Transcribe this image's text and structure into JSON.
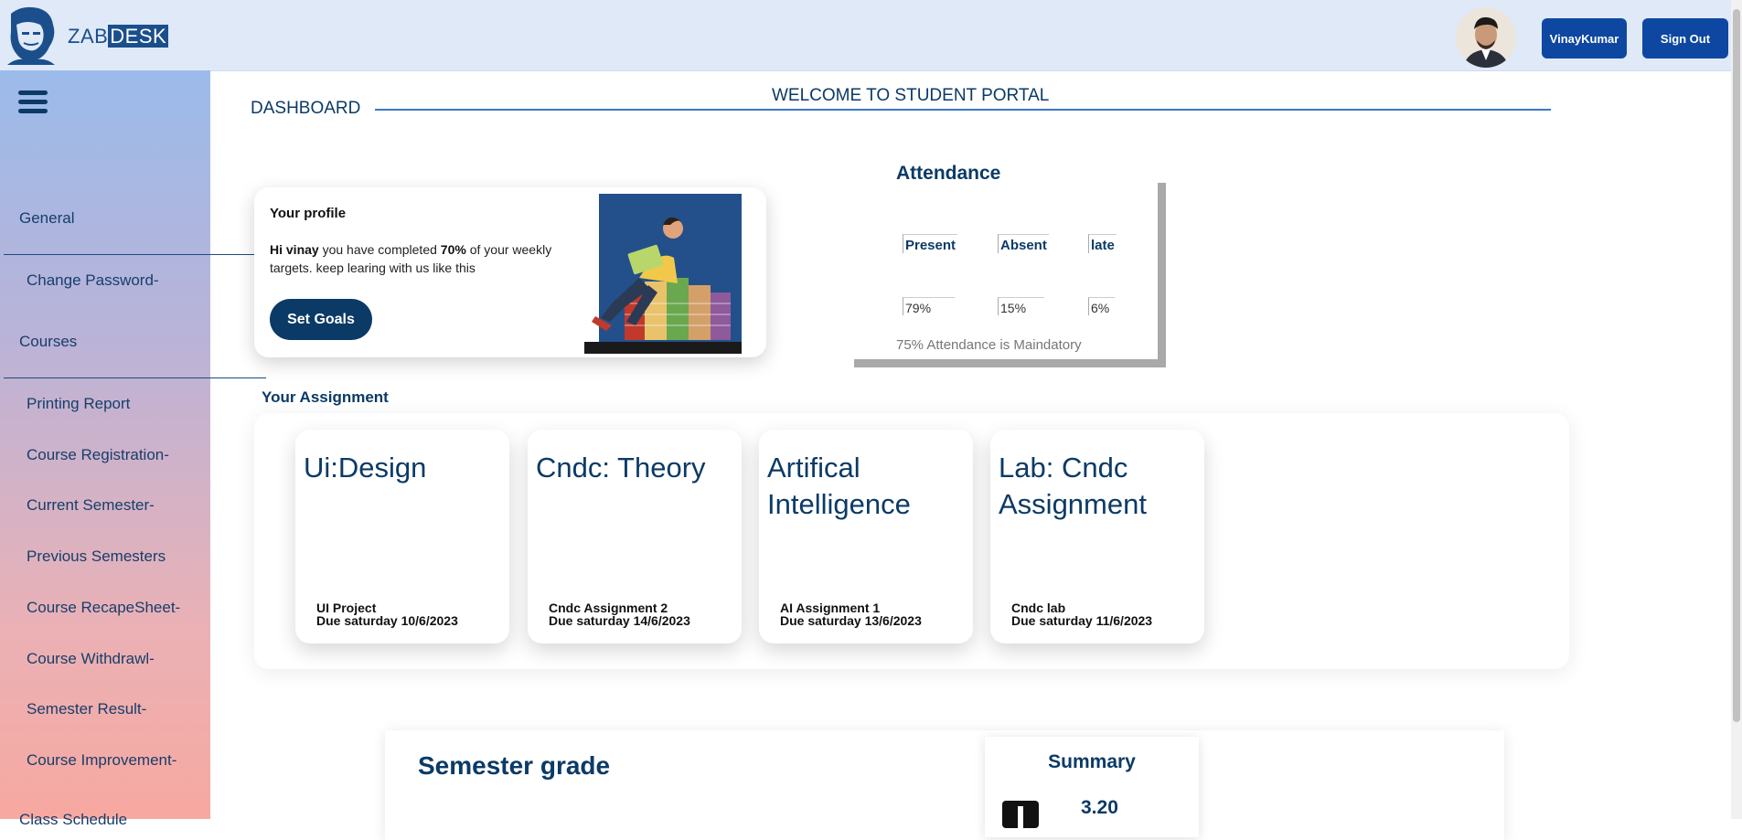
{
  "header": {
    "logo_text_zab": "ZAB",
    "logo_text_desk": "DESK",
    "user_button": "VinayKumar",
    "signout_button": "Sign Out"
  },
  "sidebar": {
    "items": [
      {
        "label": "General"
      },
      {
        "label": "Change Password-"
      },
      {
        "label": "Courses"
      },
      {
        "label": "Printing Report"
      },
      {
        "label": "Course Registration-"
      },
      {
        "label": "Current Semester-"
      },
      {
        "label": "Previous Semesters"
      },
      {
        "label": "Course RecapeSheet-"
      },
      {
        "label": "Course Withdrawl-"
      },
      {
        "label": "Semester Result-"
      },
      {
        "label": "Course Improvement-"
      },
      {
        "label": "Class Schedule"
      }
    ]
  },
  "main": {
    "dashboard_title": "DASHBOARD",
    "welcome": "WELCOME TO STUDENT PORTAL",
    "profile": {
      "title": "Your profile",
      "greeting_name": "Hi vinay",
      "text_mid": " you have completed ",
      "percent": "70%",
      "text_end": " of your weekly targets. keep learing with us like this",
      "button": "Set Goals"
    },
    "attendance": {
      "title": "Attendance",
      "headers": [
        "Present",
        "Absent",
        "late"
      ],
      "values": [
        "79%",
        "15%",
        "6%"
      ],
      "note": "75% Attendance is Maindatory"
    },
    "assignments": {
      "title": "Your Assignment",
      "cards": [
        {
          "title": "Ui:Design",
          "name": "UI Project",
          "due": "Due saturday 10/6/2023"
        },
        {
          "title": "Cndc: Theory",
          "name": "Cndc Assignment 2",
          "due": "Due saturday 14/6/2023"
        },
        {
          "title": "Artifical Intelligence",
          "name": "AI Assignment 1",
          "due": "Due saturday 13/6/2023"
        },
        {
          "title": "Lab: Cndc Assignment",
          "name": "Cndc lab",
          "due": "Due saturday 11/6/2023"
        }
      ]
    },
    "grades": {
      "title": "Semester grade",
      "summary_title": "Summary",
      "summary_value": "3.20"
    }
  },
  "colors": {
    "primary": "#0d47a1",
    "dark_navy": "#0c3a66",
    "topbar_bg": "#dfe9f8"
  }
}
